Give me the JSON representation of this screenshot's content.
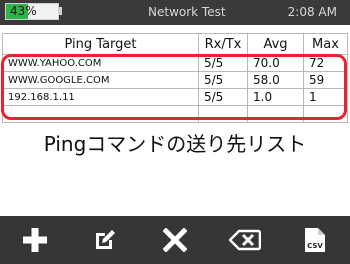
{
  "status": {
    "battery_label": "43%",
    "battery_level": 0.43,
    "title": "Network Test",
    "time": "2:08 AM"
  },
  "table": {
    "columns": [
      "Ping Target",
      "Rx/Tx",
      "Avg",
      "Max"
    ],
    "rows": [
      {
        "target": "WWW.YAHOO.COM",
        "rxtx": "5/5",
        "avg": "70.0",
        "max": "72"
      },
      {
        "target": "WWW.GOOGLE.COM",
        "rxtx": "5/5",
        "avg": "58.0",
        "max": "59"
      },
      {
        "target": "192.168.1.11",
        "rxtx": "5/5",
        "avg": "1.0",
        "max": "1"
      }
    ]
  },
  "caption": "Pingコマンドの送り先リスト",
  "toolbar": {
    "icons": [
      "plus-icon",
      "edit-icon",
      "close-icon",
      "backspace-icon",
      "csv-file-icon"
    ],
    "csv_label": "CSV"
  },
  "colors": {
    "accent": "#2fb34a",
    "highlight": "#e6232e",
    "bar": "#363636"
  }
}
